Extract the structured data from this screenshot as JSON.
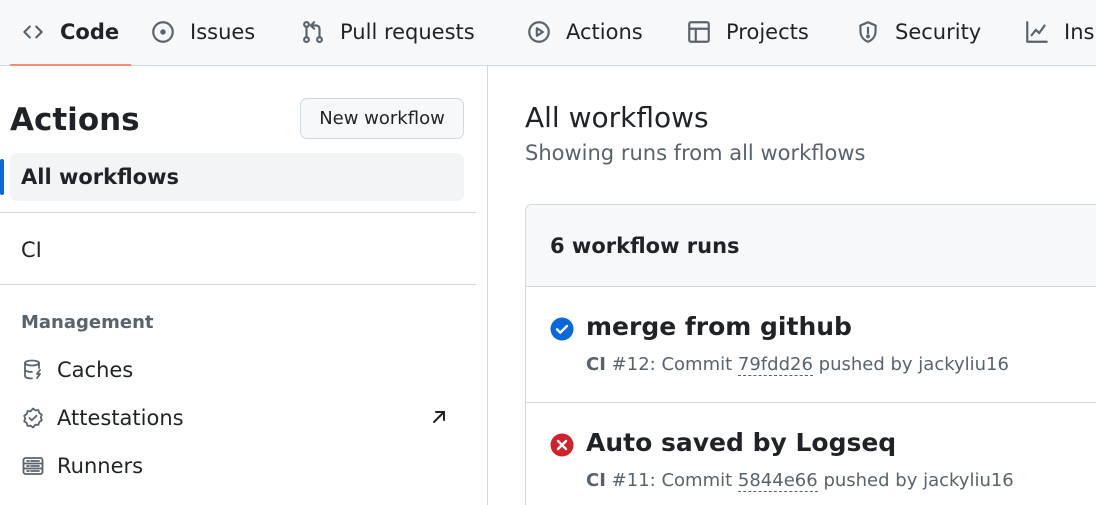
{
  "repo_nav": {
    "tabs": [
      {
        "label": "Code",
        "icon": "code-icon",
        "selected": true
      },
      {
        "label": "Issues",
        "icon": "issue-opened-icon"
      },
      {
        "label": "Pull requests",
        "icon": "git-pull-request-icon"
      },
      {
        "label": "Actions",
        "icon": "play-icon"
      },
      {
        "label": "Projects",
        "icon": "table-icon"
      },
      {
        "label": "Security",
        "icon": "shield-icon"
      },
      {
        "label": "Ins",
        "icon": "graph-icon"
      }
    ]
  },
  "sidebar": {
    "title": "Actions",
    "new_workflow_label": "New workflow",
    "workflows": [
      {
        "label": "All workflows",
        "selected": true
      },
      {
        "label": "CI"
      }
    ],
    "management": {
      "heading": "Management",
      "items": [
        {
          "label": "Caches",
          "icon": "database-icon"
        },
        {
          "label": "Attestations",
          "icon": "verified-icon",
          "external": true
        },
        {
          "label": "Runners",
          "icon": "server-icon"
        }
      ]
    }
  },
  "main": {
    "title": "All workflows",
    "subtitle": "Showing runs from all workflows",
    "runs_count_label": "6 workflow runs",
    "runs": [
      {
        "status": "success",
        "title": "merge from github",
        "workflow": "CI",
        "number": "#12",
        "event": "Commit",
        "sha": "79fdd26",
        "actor_text": "pushed by jackyliu16"
      },
      {
        "status": "failure",
        "title": "Auto saved by Logseq",
        "workflow": "CI",
        "number": "#11",
        "event": "Commit",
        "sha": "5844e66",
        "actor_text": "pushed by jackyliu16"
      }
    ]
  },
  "colors": {
    "success": "#0969da",
    "failure": "#cf222e",
    "selected_bar": "#0969da",
    "code_underline": "#fd8c73"
  }
}
